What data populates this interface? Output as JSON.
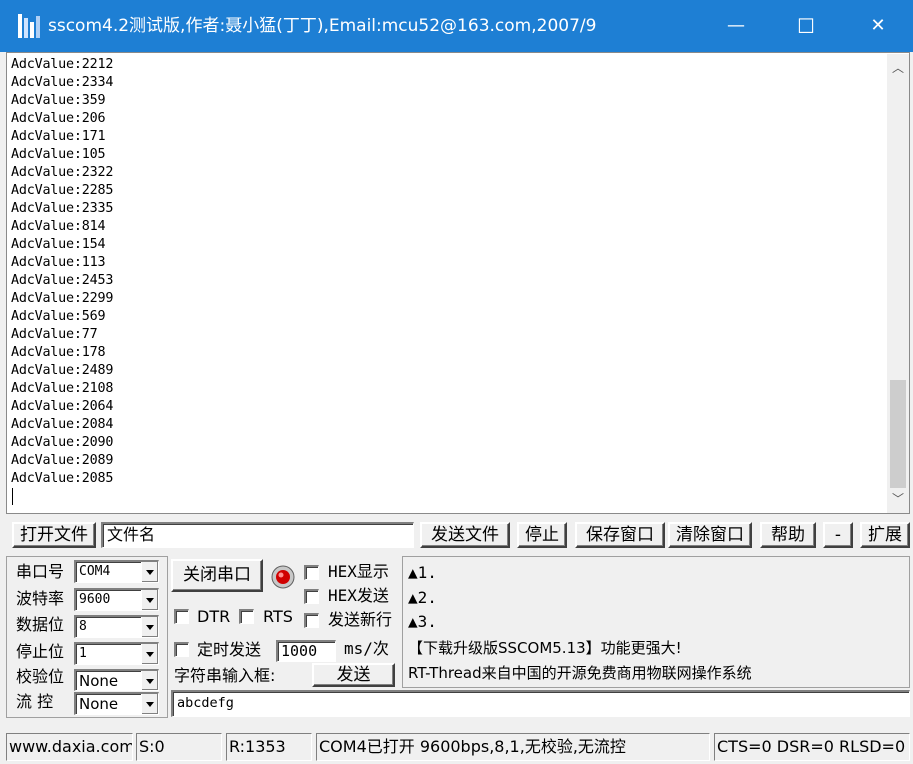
{
  "window": {
    "title": "sscom4.2测试版,作者:聂小猛(丁丁),Email:mcu52@163.com,2007/9",
    "minimize": "—",
    "maximize": "☐",
    "close": "✕",
    "accent": "#1e7fd4"
  },
  "receive": {
    "lines": [
      "AdcValue:2212",
      "AdcValue:2334",
      "AdcValue:359",
      "AdcValue:206",
      "AdcValue:171",
      "AdcValue:105",
      "AdcValue:2322",
      "AdcValue:2285",
      "AdcValue:2335",
      "AdcValue:814",
      "AdcValue:154",
      "AdcValue:113",
      "AdcValue:2453",
      "AdcValue:2299",
      "AdcValue:569",
      "AdcValue:77",
      "AdcValue:178",
      "AdcValue:2489",
      "AdcValue:2108",
      "AdcValue:2064",
      "AdcValue:2084",
      "AdcValue:2090",
      "AdcValue:2089",
      "AdcValue:2085"
    ]
  },
  "toolbar": {
    "open_file": "打开文件",
    "filename": "文件名",
    "send_file": "发送文件",
    "stop": "停止",
    "save_window": "保存窗口",
    "clear_window": "清除窗口",
    "help": "帮助",
    "minus": "-",
    "expand": "扩展"
  },
  "settings": {
    "port_label": "串口号",
    "port_value": "COM4",
    "baud_label": "波特率",
    "baud_value": "9600",
    "databits_label": "数据位",
    "databits_value": "8",
    "stopbits_label": "停止位",
    "stopbits_value": "1",
    "parity_label": "校验位",
    "parity_value": "None",
    "flow_label": "流 控",
    "flow_value": "None"
  },
  "controls": {
    "close_port": "关闭串口",
    "hex_display": "HEX显示",
    "hex_send": "HEX发送",
    "send_newline": "发送新行",
    "dtr": "DTR",
    "rts": "RTS",
    "timed_send": "定时发送",
    "interval": "1000",
    "interval_unit": "ms/次",
    "input_label": "字符串输入框:",
    "send": "发送",
    "input_value": "abcdefg"
  },
  "info": {
    "lines": [
      "▲1.",
      "▲2.",
      "▲3."
    ],
    "ad": "【下载升级版SSCOM5.13】功能更强大!",
    "rtthread": "RT-Thread来自中国的开源免费商用物联网操作系统"
  },
  "status": {
    "site": "www.daxia.com",
    "sent": "S:0",
    "received": "R:1353",
    "port_state": "COM4已打开  9600bps,8,1,无校验,无流控",
    "signals": "CTS=0 DSR=0 RLSD=0"
  }
}
